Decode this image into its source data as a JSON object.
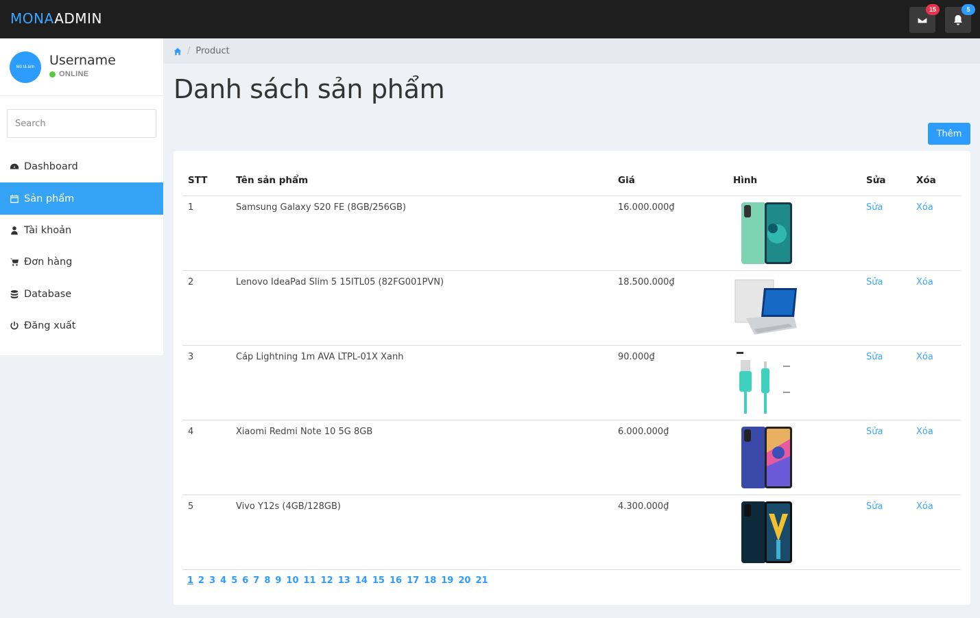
{
  "logo": {
    "part1": "MONA",
    "part2": "ADMIN"
  },
  "topbar": {
    "messages_badge": "15",
    "notifications_badge": "5",
    "badge_colors": {
      "messages": "#e8334a",
      "notifications": "#2d9cff"
    }
  },
  "profile": {
    "username": "Username",
    "status": "ONLINE",
    "avatar_text": "Mô tả ảnh"
  },
  "search": {
    "placeholder": "Search"
  },
  "nav": {
    "items": [
      {
        "label": "Dashboard",
        "icon": "dashboard-icon"
      },
      {
        "label": "Sản phẩm",
        "icon": "calendar-icon",
        "active": true
      },
      {
        "label": "Tài khoản",
        "icon": "user-icon"
      },
      {
        "label": "Đơn hàng",
        "icon": "cart-icon"
      },
      {
        "label": "Database",
        "icon": "database-icon"
      },
      {
        "label": "Đăng xuất",
        "icon": "power-icon"
      }
    ]
  },
  "breadcrumb": {
    "current": "Product"
  },
  "page": {
    "title": "Danh sách sản phẩm",
    "add_label": "Thêm"
  },
  "table": {
    "headers": {
      "stt": "STT",
      "name": "Tên sản phẩm",
      "price": "Giá",
      "image": "Hình",
      "edit": "Sửa",
      "delete": "Xóa"
    },
    "rows": [
      {
        "stt": "1",
        "name": "Samsung Galaxy S20 FE (8GB/256GB)",
        "price": "16.000.000₫",
        "image": "phone-mint-icon",
        "edit": "Sửa",
        "delete": "Xóa"
      },
      {
        "stt": "2",
        "name": "Lenovo IdeaPad Slim 5 15ITL05 (82FG001PVN)",
        "price": "18.500.000₫",
        "image": "laptop-icon",
        "edit": "Sửa",
        "delete": "Xóa"
      },
      {
        "stt": "3",
        "name": "Cáp Lightning 1m AVA LTPL-01X Xanh",
        "price": "90.000₫",
        "image": "cable-icon",
        "edit": "Sửa",
        "delete": "Xóa"
      },
      {
        "stt": "4",
        "name": "Xiaomi Redmi Note 10 5G 8GB",
        "price": "6.000.000₫",
        "image": "phone-blue-icon",
        "edit": "Sửa",
        "delete": "Xóa"
      },
      {
        "stt": "5",
        "name": "Vivo Y12s (4GB/128GB)",
        "price": "4.300.000₫",
        "image": "phone-dark-icon",
        "edit": "Sửa",
        "delete": "Xóa"
      }
    ]
  },
  "pagination": {
    "pages": [
      "1",
      "2",
      "3",
      "4",
      "5",
      "6",
      "7",
      "8",
      "9",
      "10",
      "11",
      "12",
      "13",
      "14",
      "15",
      "16",
      "17",
      "18",
      "19",
      "20",
      "21"
    ],
    "current": "1"
  }
}
